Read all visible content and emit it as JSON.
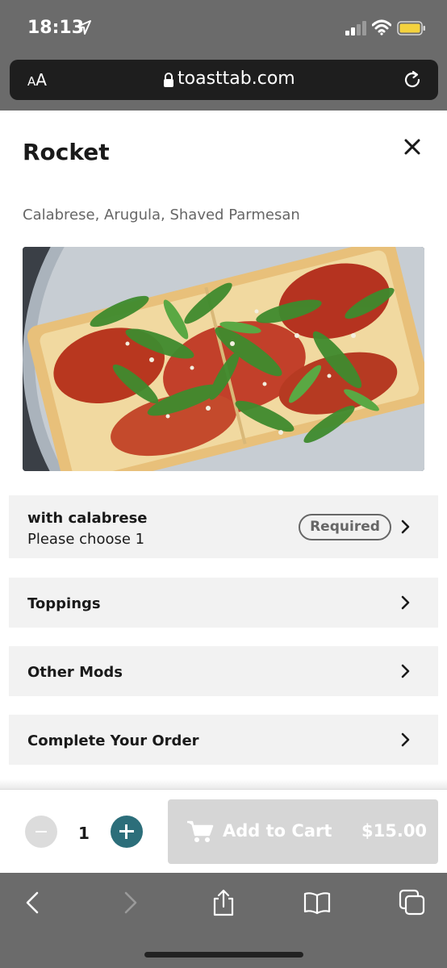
{
  "status_bar": {
    "time": "18:13",
    "icons": [
      "location-arrow-icon",
      "cellular-signal-icon",
      "wifi-icon",
      "battery-icon"
    ]
  },
  "browser": {
    "text_size_label_small": "A",
    "text_size_label_large": "A",
    "url": "toasttab.com",
    "icons": [
      "lock-icon",
      "reload-icon"
    ]
  },
  "item": {
    "name": "Rocket",
    "description": "Calabrese, Arugula, Shaved Parmesan",
    "photo_icon": "pizza-photo"
  },
  "options": [
    {
      "title": "with calabrese",
      "subtitle": "Please choose 1",
      "badge": "Required"
    },
    {
      "title": "Toppings"
    },
    {
      "title": "Other Mods"
    },
    {
      "title": "Complete Your Order"
    }
  ],
  "footer": {
    "quantity": "1",
    "add_to_cart_label": "Add to Cart",
    "price": "$15.00"
  },
  "safari_toolbar": {
    "icons": [
      "back-icon",
      "forward-icon",
      "share-icon",
      "bookmarks-icon",
      "tabs-icon"
    ]
  },
  "colors": {
    "accent": "#2c6e7a",
    "chrome": "#6b6b6b",
    "row_bg": "#f2f2f2",
    "disabled_button": "#d6d6d6"
  }
}
